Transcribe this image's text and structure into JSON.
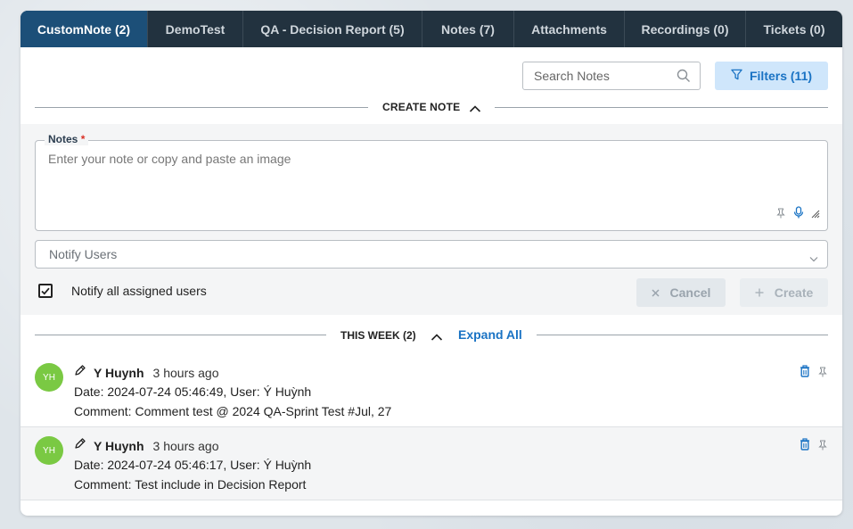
{
  "tabs": [
    {
      "label": "CustomNote (2)",
      "active": true
    },
    {
      "label": "DemoTest",
      "active": false
    },
    {
      "label": "QA - Decision Report (5)",
      "active": false
    },
    {
      "label": "Notes (7)",
      "active": false
    },
    {
      "label": "Attachments",
      "active": false
    },
    {
      "label": "Recordings (0)",
      "active": false
    },
    {
      "label": "Tickets (0)",
      "active": false
    }
  ],
  "toolbar": {
    "search_placeholder": "Search Notes",
    "filters_label": "Filters (11)"
  },
  "create_section": {
    "label": "CREATE NOTE",
    "notes_label": "Notes",
    "required_mark": "*",
    "notes_placeholder": "Enter your note or copy and paste an image",
    "notify_placeholder": "Notify Users",
    "notify_all_label": "Notify all assigned users",
    "notify_all_checked": true,
    "cancel_label": "Cancel",
    "create_label": "Create"
  },
  "week_section": {
    "label": "THIS WEEK (2)",
    "expand_label": "Expand All"
  },
  "notes": [
    {
      "initials": "YH",
      "author": "Y Huynh",
      "time": "3 hours ago",
      "date_line": "Date: 2024-07-24 05:46:49, User: Ý Huỳnh",
      "comment_line": "Comment: Comment test @ 2024 QA-Sprint Test #Jul, 27"
    },
    {
      "initials": "YH",
      "author": "Y Huynh",
      "time": "3 hours ago",
      "date_line": "Date: 2024-07-24 05:46:17, User: Ý Huỳnh",
      "comment_line": "Comment: Test include in Decision Report"
    }
  ],
  "colors": {
    "tab_bar": "#22323f",
    "tab_active": "#1c4f78",
    "accent": "#1a73c4",
    "avatar": "#7ac943"
  }
}
